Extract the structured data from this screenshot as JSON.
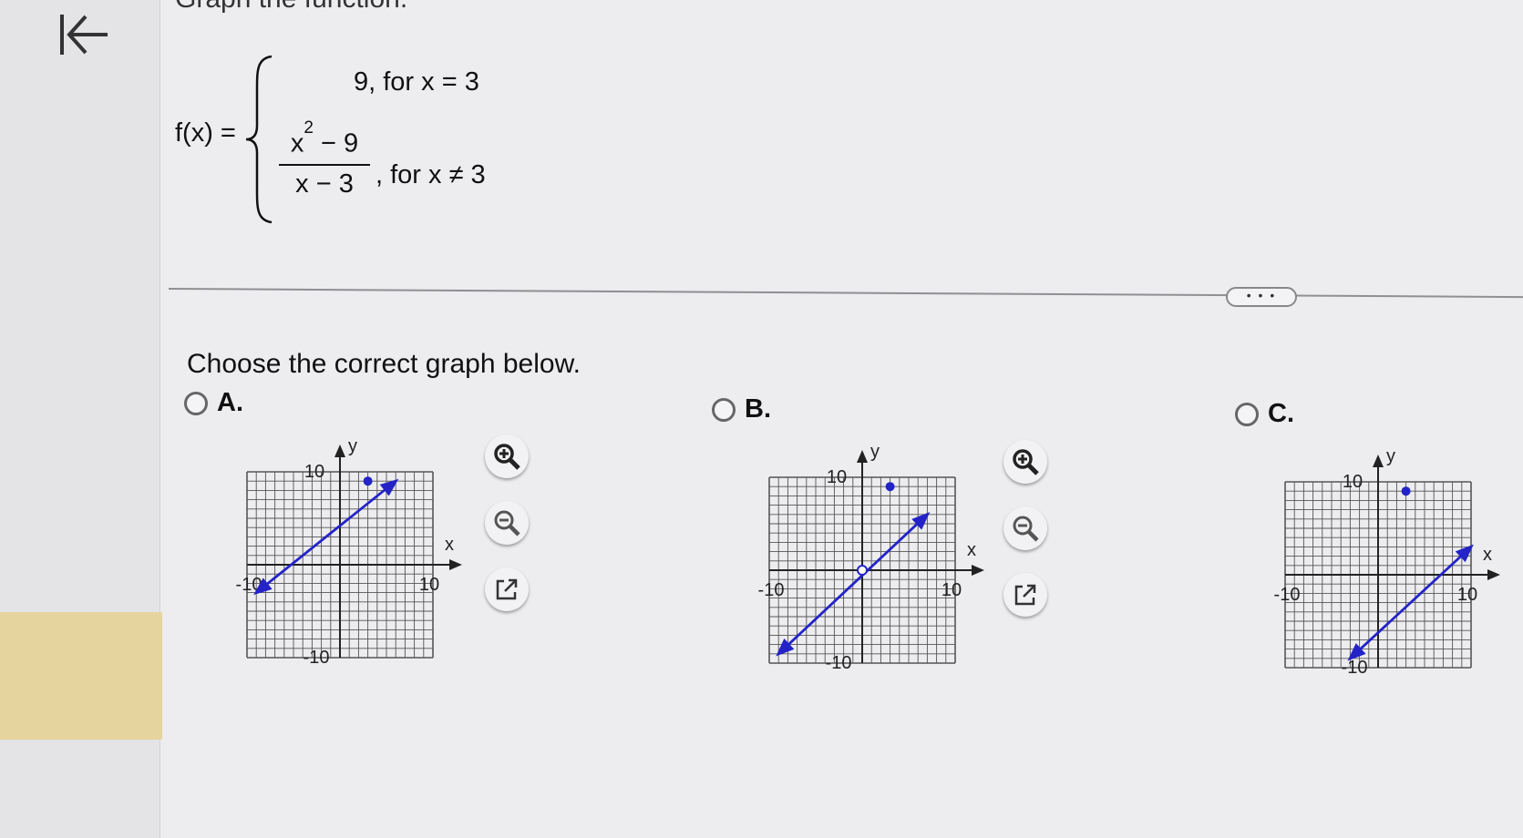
{
  "heading_cut": "Graph the function.",
  "function": {
    "lhs": "f(x) =",
    "case1": "9, for x = 3",
    "case2_numerator": "x",
    "case2_numerator_exp": "2",
    "case2_numerator_rest": " − 9",
    "case2_denominator": "x − 3",
    "case2_condition": ", for x ≠ 3"
  },
  "more_button": "• • •",
  "prompt": "Choose the correct graph below.",
  "options": [
    {
      "letter": "A.",
      "xlabel": "x",
      "ylabel": "y",
      "tick_y_top": "10",
      "tick_x_left": "-10",
      "tick_x_right": "10",
      "tick_y_bottom": "-10",
      "line": [
        [
          -9,
          -3
        ],
        [
          6,
          9
        ]
      ],
      "dot": [
        3,
        9
      ],
      "hole": null
    },
    {
      "letter": "B.",
      "xlabel": "x",
      "ylabel": "y",
      "tick_y_top": "10",
      "tick_x_left": "-10",
      "tick_x_right": "10",
      "tick_y_bottom": "-10",
      "line": [
        [
          -9,
          -9
        ],
        [
          7,
          6
        ]
      ],
      "dot": [
        3,
        9
      ],
      "hole": [
        0,
        0
      ]
    },
    {
      "letter": "C.",
      "xlabel": "x",
      "ylabel": "y",
      "tick_y_top": "10",
      "tick_x_left": "-10",
      "tick_x_right": "10",
      "tick_y_bottom": "-10",
      "line": [
        [
          -3,
          -9
        ],
        [
          10,
          3
        ]
      ],
      "dot": [
        3,
        9
      ],
      "hole": null
    }
  ],
  "icons": {
    "zoom_in": "zoom-in-icon",
    "zoom_out": "zoom-out-icon",
    "popout": "popout-icon",
    "back": "back-arrow-icon"
  },
  "colors": {
    "line": "#2323c8",
    "grid": "#555555",
    "highlight": "#e6d49f"
  }
}
